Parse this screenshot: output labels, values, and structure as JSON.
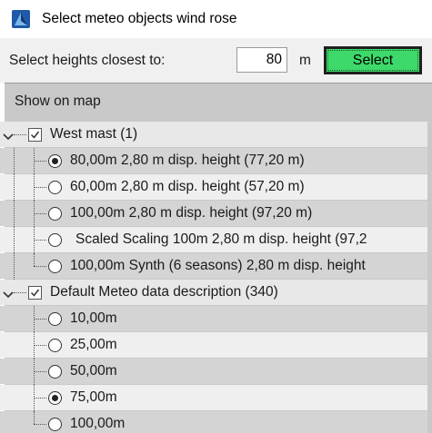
{
  "window": {
    "title": "Select meteo objects wind rose"
  },
  "toolbar": {
    "label": "Select heights closest to:",
    "height_value": "80",
    "unit": "m",
    "select_label": "Select",
    "select_color": "#3dd96a"
  },
  "panel": {
    "header_label": "Show on map"
  },
  "tree": {
    "groups": [
      {
        "label": "West mast (1)",
        "checked": true,
        "expanded": true,
        "items": [
          {
            "label": "80,00m  2,80 m disp. height (77,20 m)",
            "selected": true
          },
          {
            "label": "60,00m  2,80 m disp. height (57,20 m)",
            "selected": false
          },
          {
            "label": "100,00m  2,80 m disp. height (97,20 m)",
            "selected": false
          },
          {
            "label": "Scaled Scaling 100m 2,80 m disp. height (97,2",
            "selected": false
          },
          {
            "label": "100,00m Synth (6 seasons) 2,80 m disp. height",
            "selected": false
          }
        ]
      },
      {
        "label": "Default Meteo data description (340)",
        "checked": true,
        "expanded": true,
        "items": [
          {
            "label": "10,00m",
            "selected": false
          },
          {
            "label": "25,00m",
            "selected": false
          },
          {
            "label": "50,00m",
            "selected": false
          },
          {
            "label": "75,00m",
            "selected": true
          },
          {
            "label": "100,00m",
            "selected": false
          }
        ]
      }
    ]
  }
}
